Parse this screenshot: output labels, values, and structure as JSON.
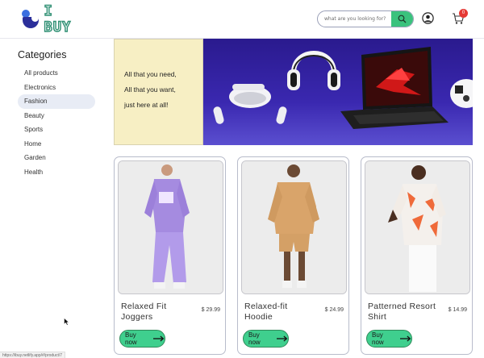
{
  "brand": {
    "name": "I BUY"
  },
  "search": {
    "placeholder": "what are you looking for?"
  },
  "cart": {
    "count": "0"
  },
  "sidebar": {
    "title": "Categories",
    "items": [
      {
        "label": "All products"
      },
      {
        "label": "Electronics"
      },
      {
        "label": "Fashion"
      },
      {
        "label": "Beauty"
      },
      {
        "label": "Sports"
      },
      {
        "label": "Home"
      },
      {
        "label": "Garden"
      },
      {
        "label": "Health"
      }
    ],
    "active": "Fashion"
  },
  "banner": {
    "lines": [
      "All that you need,",
      "All that you want,",
      "just here at all!"
    ]
  },
  "products": [
    {
      "name": "Relaxed Fit Joggers",
      "price": "$ 29.99",
      "cta": "Buy now"
    },
    {
      "name": "Relaxed-fit Hoodie",
      "price": "$ 24.99",
      "cta": "Buy now"
    },
    {
      "name": "Patterned Resort Shirt",
      "price": "$ 14.99",
      "cta": "Buy now"
    }
  ],
  "status_bar": {
    "url": "https://ibuy.netlify.app/#/product/7"
  },
  "colors": {
    "accent": "#3fcf8e",
    "brand_blue": "#2b2f9a",
    "badge": "#e53935"
  }
}
